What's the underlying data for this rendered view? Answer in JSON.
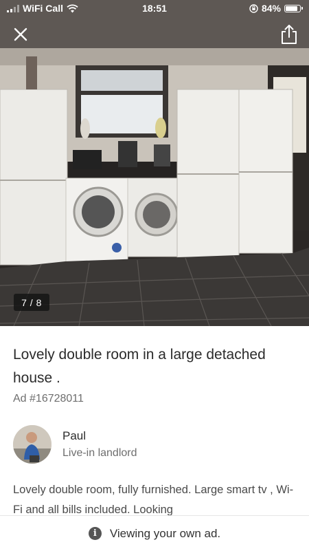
{
  "status_bar": {
    "carrier": "WiFi Call",
    "time": "18:51",
    "battery_percent": "84%",
    "battery_level": 0.84,
    "icons": [
      "signal-icon",
      "wifi-icon",
      "orientation-lock-icon",
      "battery-icon"
    ]
  },
  "gallery": {
    "counter": "7 / 8",
    "close_icon": "close-icon",
    "share_icon": "share-icon",
    "photo_description_icon": "kitchen-photo"
  },
  "listing": {
    "title": "Lovely double room in a large detached house .",
    "ad_id": "Ad #16728011"
  },
  "seller": {
    "name": "Paul",
    "role": "Live-in landlord"
  },
  "description": "Lovely double room, fully furnished. Large smart tv , Wi-Fi and all bills included. Looking",
  "footer": {
    "icon": "info-icon",
    "message": "Viewing your own ad."
  },
  "colors": {
    "text_primary": "#2b2b2b",
    "text_secondary": "#6e6e6e",
    "counter_bg": "#141414"
  }
}
